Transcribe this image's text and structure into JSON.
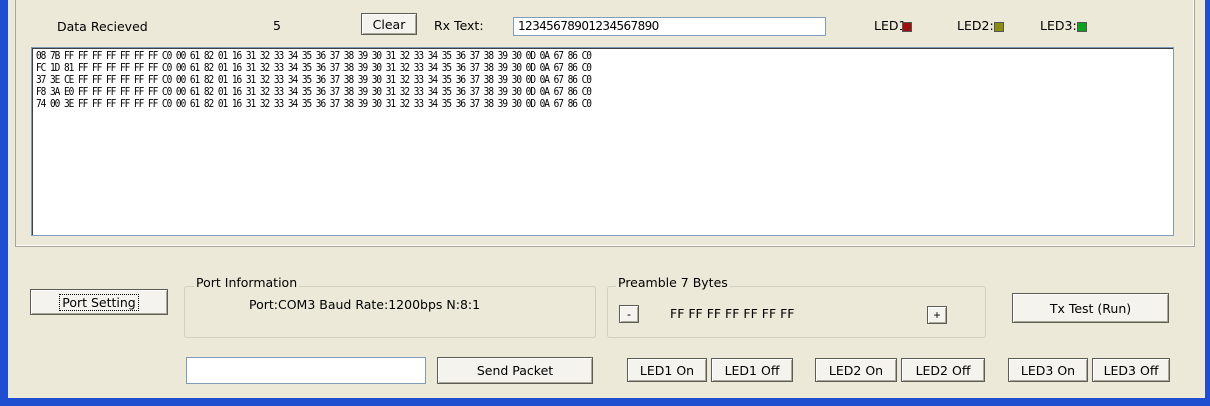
{
  "header": {
    "data_received_label": "Data Recieved",
    "data_received_count": "5",
    "clear_button": "Clear",
    "rx_text_label": "Rx Text:",
    "rx_text_value": "12345678901234567890",
    "led1_label": "LED1:",
    "led2_label": "LED2:",
    "led3_label": "LED3:",
    "led1_color": "#a01010",
    "led2_color": "#8c8c10",
    "led3_color": "#10a020"
  },
  "hex_lines": [
    "08 7B FF FF FF FF FF FF FF C0 00 61 82 01 16 31 32 33 34 35 36 37 38 39 30 31 32 33 34 35 36 37 38 39 30 0D 0A 67 86 C0",
    "FC 1D 81 FF FF FF FF FF FF C0 00 61 82 01 16 31 32 33 34 35 36 37 38 39 30 31 32 33 34 35 36 37 38 39 30 0D 0A 67 86 C0",
    "37 3E CE FF FF FF FF FF FF C0 00 61 82 01 16 31 32 33 34 35 36 37 38 39 30 31 32 33 34 35 36 37 38 39 30 0D 0A 67 86 C0",
    "F8 3A E0 FF FF FF FF FF FF C0 00 61 82 01 16 31 32 33 34 35 36 37 38 39 30 31 32 33 34 35 36 37 38 39 30 0D 0A 67 86 C0",
    "74 00 3E FF FF FF FF FF FF C0 00 61 82 01 16 31 32 33 34 35 36 37 38 39 30 31 32 33 34 35 36 37 38 39 30 0D 0A 67 86 C0"
  ],
  "port_setting_button": "Port Setting",
  "port_info": {
    "title": "Port Information",
    "text": "Port:COM3  Baud Rate:1200bps  N:8:1"
  },
  "preamble": {
    "title": "Preamble 7 Bytes",
    "minus_button": "-",
    "value": "FF FF FF FF FF FF FF",
    "plus_button": "+"
  },
  "tx_test_button": "Tx Test (Run)",
  "send": {
    "input_value": "",
    "button": "Send Packet"
  },
  "led_buttons": {
    "led1_on": "LED1 On",
    "led1_off": "LED1 Off",
    "led2_on": "LED2 On",
    "led2_off": "LED2 Off",
    "led3_on": "LED3 On",
    "led3_off": "LED3 Off"
  }
}
